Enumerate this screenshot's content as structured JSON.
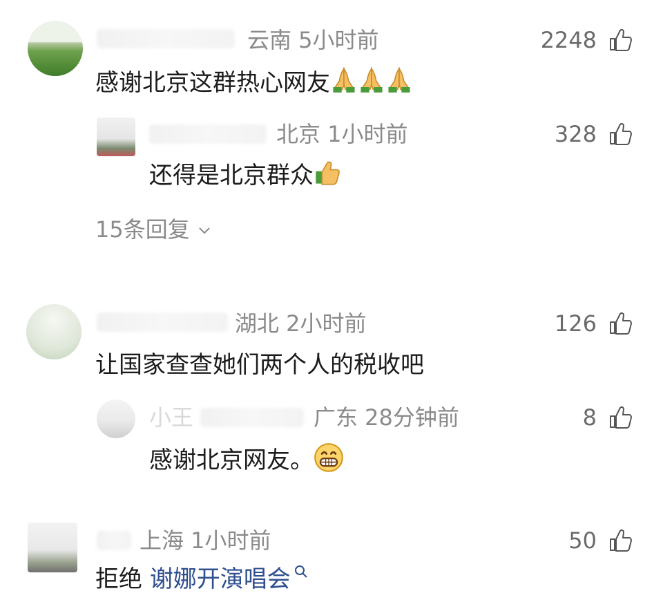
{
  "comments": [
    {
      "location_time": "云南 5小时前",
      "likes": "2248",
      "text": "感谢北京这群热心网友",
      "emoji": "pray-emoji x3",
      "reply_preview": {
        "location_time": "北京 1小时前",
        "likes": "328",
        "text": "还得是北京群众",
        "emoji": "thumbs-up-emoji"
      },
      "replies_label": "15条回复"
    },
    {
      "location_time": "湖北 2小时前",
      "likes": "126",
      "text": "让国家查查她们两个人的税收吧",
      "reply_preview": {
        "name": "小王",
        "location_time": "广东 28分钟前",
        "likes": "8",
        "text": "感谢北京网友。",
        "emoji": "grinning-face-emoji"
      }
    },
    {
      "location_time": "上海 1小时前",
      "likes": "50",
      "text_prefix": "拒绝 ",
      "text_link": "谢娜开演唱会",
      "search_icon": "search-icon"
    }
  ],
  "colors": {
    "meta": "#8a8a8a",
    "text": "#1c1c1c",
    "link": "#2f4f8f",
    "likes": "#6a6a6a"
  }
}
